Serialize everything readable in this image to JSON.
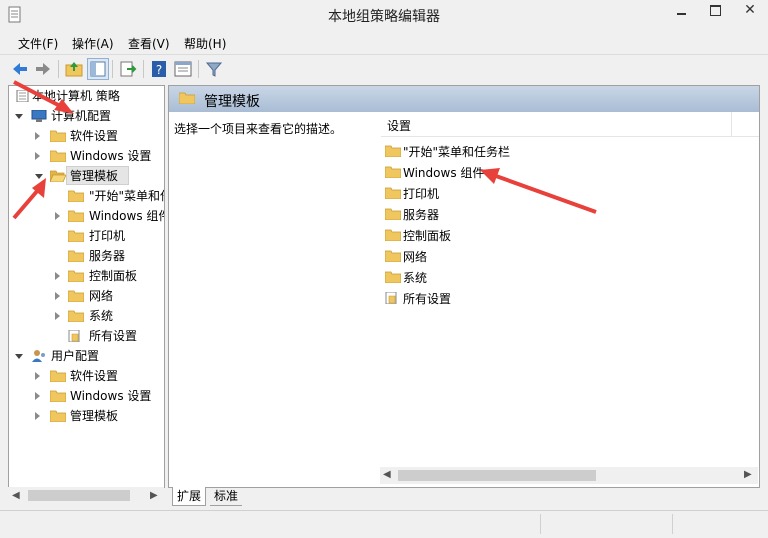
{
  "window": {
    "title": "本地组策略编辑器"
  },
  "menu": [
    "文件(F)",
    "操作(A)",
    "查看(V)",
    "帮助(H)"
  ],
  "tree": [
    {
      "label": "本地计算机 策略",
      "depth": 0,
      "expander": "none",
      "icon": "policy-icon"
    },
    {
      "label": "计算机配置",
      "depth": 1,
      "expander": "expanded",
      "icon": "computer-icon"
    },
    {
      "label": "软件设置",
      "depth": 2,
      "expander": "collapsed",
      "icon": "folder-icon"
    },
    {
      "label": "Windows 设置",
      "depth": 2,
      "expander": "collapsed",
      "icon": "folder-icon"
    },
    {
      "label": "管理模板",
      "depth": 2,
      "expander": "expanded",
      "icon": "folder-open-icon",
      "selected": true
    },
    {
      "label": "\"开始\"菜单和任务栏",
      "depth": 3,
      "expander": "none",
      "icon": "folder-icon"
    },
    {
      "label": "Windows 组件",
      "depth": 3,
      "expander": "collapsed",
      "icon": "folder-icon"
    },
    {
      "label": "打印机",
      "depth": 3,
      "expander": "none",
      "icon": "folder-icon"
    },
    {
      "label": "服务器",
      "depth": 3,
      "expander": "none",
      "icon": "folder-icon"
    },
    {
      "label": "控制面板",
      "depth": 3,
      "expander": "collapsed",
      "icon": "folder-icon"
    },
    {
      "label": "网络",
      "depth": 3,
      "expander": "collapsed",
      "icon": "folder-icon"
    },
    {
      "label": "系统",
      "depth": 3,
      "expander": "collapsed",
      "icon": "folder-icon"
    },
    {
      "label": "所有设置",
      "depth": 3,
      "expander": "none",
      "icon": "settings-page-icon"
    },
    {
      "label": "用户配置",
      "depth": 1,
      "expander": "expanded",
      "icon": "user-icon"
    },
    {
      "label": "软件设置",
      "depth": 2,
      "expander": "collapsed",
      "icon": "folder-icon"
    },
    {
      "label": "Windows 设置",
      "depth": 2,
      "expander": "collapsed",
      "icon": "folder-icon"
    },
    {
      "label": "管理模板",
      "depth": 2,
      "expander": "collapsed",
      "icon": "folder-icon"
    }
  ],
  "right": {
    "header_title": "管理模板",
    "description": "选择一个项目来查看它的描述。",
    "column_header": "设置",
    "items": [
      {
        "label": "\"开始\"菜单和任务栏",
        "icon": "folder-icon"
      },
      {
        "label": "Windows 组件",
        "icon": "folder-icon"
      },
      {
        "label": "打印机",
        "icon": "folder-icon"
      },
      {
        "label": "服务器",
        "icon": "folder-icon"
      },
      {
        "label": "控制面板",
        "icon": "folder-icon"
      },
      {
        "label": "网络",
        "icon": "folder-icon"
      },
      {
        "label": "系统",
        "icon": "folder-icon"
      },
      {
        "label": "所有设置",
        "icon": "settings-page-icon"
      }
    ]
  },
  "tabs": [
    "扩展",
    "标准"
  ],
  "colors": {
    "header_gradient_top": "#c9d6e6",
    "header_gradient_bottom": "#a9bdd5",
    "arrow": "#e8403a",
    "folder": "#f0c75e"
  }
}
